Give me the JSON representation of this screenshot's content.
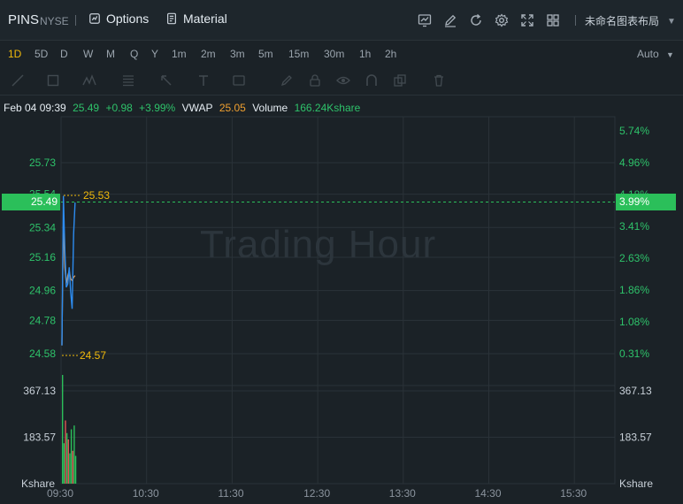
{
  "header": {
    "ticker": "PINS",
    "exchange": "NYSE",
    "options_label": "Options",
    "material_label": "Material",
    "layout_name": "未命名图表布局",
    "icons": [
      "chart-icon",
      "edit-icon",
      "refresh-icon",
      "settings-icon",
      "fullscreen-icon",
      "layout-grid-icon"
    ]
  },
  "periods": [
    {
      "label": "1D",
      "active": true
    },
    {
      "label": "5D",
      "active": false
    },
    {
      "label": "D",
      "active": false
    },
    {
      "label": "W",
      "active": false
    },
    {
      "label": "M",
      "active": false
    },
    {
      "label": "Q",
      "active": false
    },
    {
      "label": "Y",
      "active": false
    },
    {
      "label": "1m",
      "active": false
    },
    {
      "label": "2m",
      "active": false
    },
    {
      "label": "3m",
      "active": false
    },
    {
      "label": "5m",
      "active": false
    },
    {
      "label": "15m",
      "active": false
    },
    {
      "label": "30m",
      "active": false
    },
    {
      "label": "1h",
      "active": false
    },
    {
      "label": "2h",
      "active": false
    }
  ],
  "scale_mode": "Auto",
  "drawing_tools": [
    "trendline-icon",
    "rectangle-icon",
    "pattern-icon",
    "fib-icon",
    "arrow-icon",
    "text-icon",
    "label-icon",
    "brush-icon",
    "lock-icon",
    "eye-icon",
    "magnet-icon",
    "clone-icon",
    "trash-icon"
  ],
  "info": {
    "datetime": "Feb 04 09:39",
    "price": "25.49",
    "change": "+0.98",
    "change_pct": "+3.99%",
    "vwap_label": "VWAP",
    "vwap": "25.05",
    "volume_label": "Volume",
    "volume": "166.24Kshare"
  },
  "watermark": "Trading Hour",
  "colors": {
    "up": "#2bbf5a",
    "price_line": "#2d8cf0",
    "vwap_line": "#e0a060",
    "marker": "#f0b90b",
    "grid": "#2a3238"
  },
  "chart_data": {
    "type": "line",
    "price_axis": [
      "25.73",
      "25.54",
      "25.34",
      "25.16",
      "24.96",
      "24.78",
      "24.58"
    ],
    "percent_axis": [
      "5.74%",
      "4.96%",
      "4.18%",
      "3.41%",
      "2.63%",
      "1.86%",
      "1.08%",
      "0.31%"
    ],
    "volume_axis": [
      "367.13",
      "183.57"
    ],
    "volume_unit": "Kshare",
    "time_axis": [
      "09:30",
      "10:30",
      "11:30",
      "12:30",
      "13:30",
      "14:30",
      "15:30"
    ],
    "current_price": "25.49",
    "current_pct": "3.99%",
    "high_marker": "25.53",
    "low_marker": "24.57",
    "price_series": {
      "name": "Price",
      "x": [
        "09:30",
        "09:31",
        "09:32",
        "09:33",
        "09:34",
        "09:35",
        "09:36",
        "09:37",
        "09:38",
        "09:39"
      ],
      "values": [
        24.63,
        25.53,
        25.2,
        24.98,
        25.0,
        25.1,
        24.95,
        24.85,
        25.3,
        25.49
      ]
    },
    "vwap_series": {
      "name": "VWAP",
      "x": [
        "09:30",
        "09:31",
        "09:32",
        "09:33",
        "09:34",
        "09:35",
        "09:36",
        "09:37",
        "09:38",
        "09:39"
      ],
      "values": [
        24.63,
        25.4,
        25.1,
        25.0,
        25.05,
        25.08,
        25.03,
        25.02,
        25.04,
        25.05
      ]
    },
    "volume_series": {
      "name": "Volume",
      "x": [
        "09:30",
        "09:31",
        "09:32",
        "09:33",
        "09:34",
        "09:35",
        "09:36",
        "09:37",
        "09:38",
        "09:39"
      ],
      "values": [
        430,
        160,
        250,
        200,
        175,
        120,
        215,
        130,
        230,
        110
      ],
      "up": [
        true,
        true,
        false,
        true,
        false,
        true,
        true,
        false,
        true,
        true
      ]
    }
  }
}
